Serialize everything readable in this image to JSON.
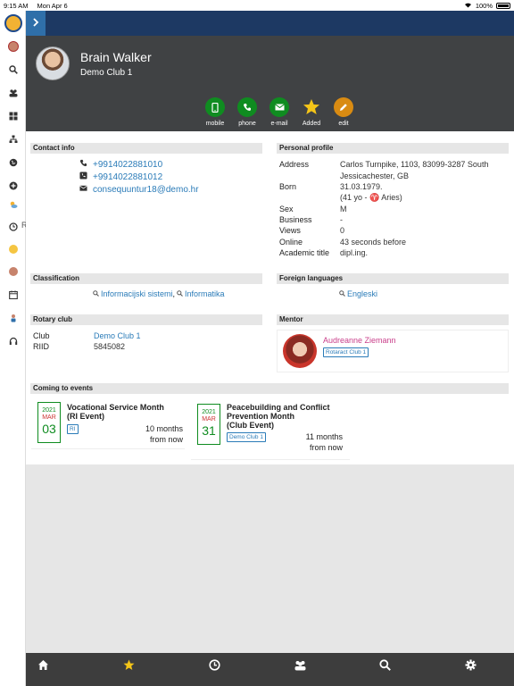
{
  "status": {
    "time": "9:15 AM",
    "date": "Mon Apr 6",
    "battery": "100%"
  },
  "profile": {
    "name": "Brain Walker",
    "club": "Demo Club 1"
  },
  "actions": [
    {
      "label": "mobile",
      "icon": "mobile-icon"
    },
    {
      "label": "phone",
      "icon": "phone-icon"
    },
    {
      "label": "e-mail",
      "icon": "email-icon"
    },
    {
      "label": "Added",
      "icon": "star-icon"
    },
    {
      "label": "edit",
      "icon": "pencil-icon"
    }
  ],
  "contact": {
    "title": "Contact info",
    "mobile": "+9914022881010",
    "phone": "+9914022881012",
    "email": "consequuntur18@demo.hr"
  },
  "personal": {
    "title": "Personal profile",
    "address_label": "Address",
    "address_line1": "Carlos Turnpike, 1103, 83099-3287 South",
    "address_line2": "Jessicachester, GB",
    "born_label": "Born",
    "born_value": "31.03.1979.",
    "born_detail": "(41 yo - ♈ Aries)",
    "sex_label": "Sex",
    "sex_value": "M",
    "business_label": "Business",
    "business_value": "-",
    "views_label": "Views",
    "views_value": "0",
    "online_label": "Online",
    "online_value": "43 seconds before",
    "academic_label": "Academic title",
    "academic_value": "dipl.ing."
  },
  "classification": {
    "title": "Classification",
    "items": [
      "Informacijski sistemi",
      "Informatika"
    ]
  },
  "languages": {
    "title": "Foreign languages",
    "items": [
      "Engleski"
    ]
  },
  "rotary": {
    "title": "Rotary club",
    "club_label": "Club",
    "club_value": "Demo Club 1",
    "riid_label": "RIID",
    "riid_value": "5845082"
  },
  "mentor": {
    "title": "Mentor",
    "name": "Audreanne Ziemann",
    "club": "Rotaract Club 1"
  },
  "events": {
    "title": "Coming to events",
    "items": [
      {
        "year": "2021",
        "month": "MAR",
        "day": "03",
        "title_line1": "Vocational Service Month",
        "title_line2": "(RI Event)",
        "title_line3": "",
        "badge": "RI",
        "time_line1": "10 months",
        "time_line2": "from now"
      },
      {
        "year": "2021",
        "month": "MAR",
        "day": "31",
        "title_line1": "Peacebuilding and Conflict",
        "title_line2": "Prevention Month",
        "title_line3": "(Club Event)",
        "badge": "Demo Club 1",
        "time_line1": "11 months",
        "time_line2": "from now"
      }
    ]
  },
  "sidebar": {
    "partial_label": "R"
  },
  "colors": {
    "topbar": "#1d3963",
    "profile_bg": "#404244",
    "green": "#0f8c20",
    "orange": "#d98b12",
    "link": "#2a7bb8",
    "mentor": "#c93e8a"
  }
}
